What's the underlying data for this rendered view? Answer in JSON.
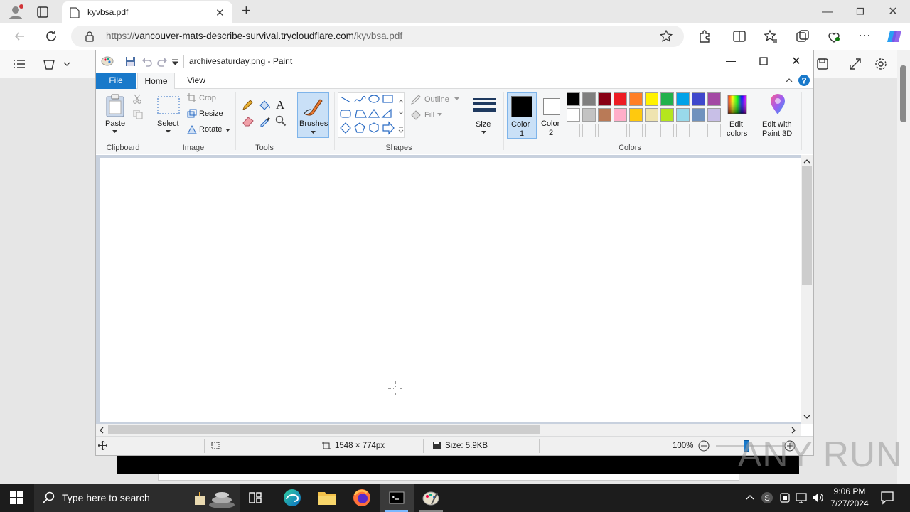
{
  "browser": {
    "tab_title": "kyvbsa.pdf",
    "url_prefix": "https://",
    "url_domain": "vancouver-mats-describe-survival.trycloudflare.com",
    "url_path": "/kyvbsa.pdf"
  },
  "paint": {
    "window_title": "archivesaturday.png - Paint",
    "tabs": [
      "File",
      "Home",
      "View"
    ],
    "clipboard": {
      "paste": "Paste",
      "group": "Clipboard"
    },
    "image": {
      "select": "Select",
      "crop": "Crop",
      "resize": "Resize",
      "rotate": "Rotate",
      "group": "Image"
    },
    "tools": {
      "group": "Tools"
    },
    "brushes": "Brushes",
    "shapes": {
      "outline": "Outline",
      "fill": "Fill",
      "group": "Shapes"
    },
    "size": "Size",
    "color1": {
      "line1": "Color",
      "line2": "1"
    },
    "color2": {
      "line1": "Color",
      "line2": "2"
    },
    "colors_group": "Colors",
    "edit_colors": {
      "line1": "Edit",
      "line2": "colors"
    },
    "paint3d": {
      "line1": "Edit with",
      "line2": "Paint 3D"
    },
    "palette_row1": [
      "#000000",
      "#7f7f7f",
      "#880015",
      "#ed1c24",
      "#ff7f27",
      "#fff200",
      "#22b14c",
      "#00a2e8",
      "#3f48cc",
      "#a349a4"
    ],
    "palette_row2": [
      "#ffffff",
      "#c3c3c3",
      "#b97a57",
      "#ffaec9",
      "#ffc90e",
      "#efe4b0",
      "#b5e61d",
      "#99d9ea",
      "#7092be",
      "#c8bfe7"
    ],
    "status": {
      "dimensions": "1548 × 774px",
      "size": "Size: 5.9KB",
      "zoom": "100%"
    }
  },
  "taskbar": {
    "search_placeholder": "Type here to search",
    "time": "9:06 PM",
    "date": "7/27/2024"
  },
  "watermark": "ANY RUN"
}
